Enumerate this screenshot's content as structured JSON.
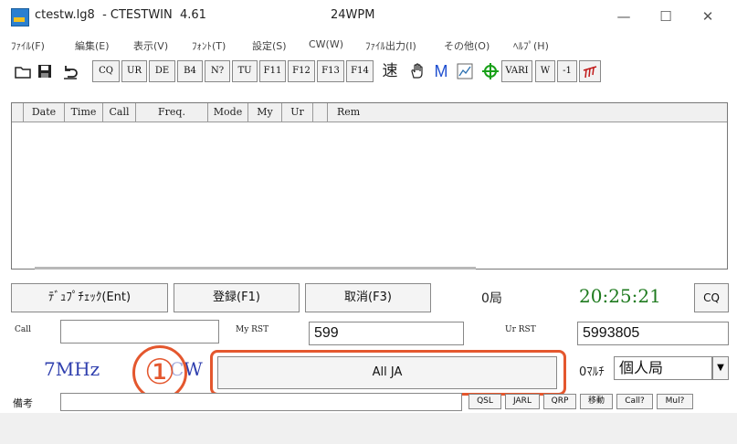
{
  "window": {
    "title": "ctestw.lg8  - CTESTWIN  4.61",
    "wpm": "24WPM",
    "minimize": "—",
    "maximize": "☐",
    "close": "✕"
  },
  "menu": [
    "ﾌｧｲﾙ(F)",
    "編集(E)",
    "表示(V)",
    "ﾌｫﾝﾄ(T)",
    "設定(S)",
    "CW(W)",
    "ﾌｧｲﾙ出力(I)",
    "その他(O)",
    "ﾍﾙﾌﾟ(H)"
  ],
  "toolbar": {
    "buttons": [
      "CQ",
      "UR",
      "DE",
      "B4",
      "N?",
      "TU",
      "F11",
      "F12",
      "F13",
      "F14"
    ],
    "speed_label": "速",
    "m_label": "M",
    "vari_label": "VARI",
    "w_label": "W",
    "minus1_label": "-1"
  },
  "log": {
    "columns": [
      "Date",
      "Time",
      "Call",
      "Freq.",
      "Mode",
      "My",
      "Ur",
      "",
      "Rem"
    ]
  },
  "controls": {
    "dupe_check": "ﾃﾞｭﾌﾟﾁｪｯｸ(Ent)",
    "register": "登録(F1)",
    "cancel": "取消(F3)",
    "qso_count": "0局",
    "clock": "20:25:21",
    "cq_button": "CQ"
  },
  "entry": {
    "call_label": "Call",
    "call_value": "",
    "myrst_label": "My RST",
    "myrst_value": "599",
    "urrst_label": "Ur RST",
    "urrst_value": "5993805",
    "band": "7MHz",
    "mode": "CW",
    "contest": "All JA",
    "multi_label": "0ﾏﾙﾁ",
    "category": "個人局",
    "remarks_label": "備考",
    "remarks_value": ""
  },
  "bottom_buttons": [
    "QSL",
    "JARL",
    "QRP",
    "移動",
    "Call?",
    "Mul?"
  ],
  "annotation": {
    "marker": "①",
    "color": "#e4572e"
  },
  "colors": {
    "band_text": "#2f3fae",
    "clock_text": "#1e7a1e"
  }
}
